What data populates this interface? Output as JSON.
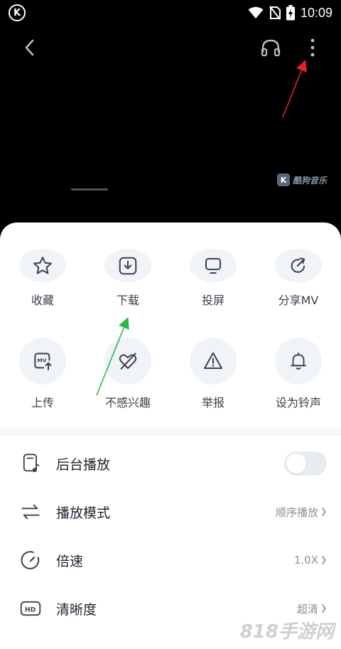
{
  "status": {
    "app_badge": "K",
    "time": "10:09",
    "icons": [
      "wifi-icon",
      "no-sim-icon",
      "battery-icon"
    ]
  },
  "player_nav": {
    "icons": [
      "back-arrow-icon",
      "headphones-icon",
      "more-vertical-icon"
    ]
  },
  "video": {
    "watermark": "酷狗音乐",
    "watermark_logo": "K"
  },
  "actions": [
    {
      "label": "收藏",
      "icon": "star-icon"
    },
    {
      "label": "下载",
      "icon": "download-icon"
    },
    {
      "label": "投屏",
      "icon": "cast-screen-icon"
    },
    {
      "label": "分享MV",
      "icon": "share-icon"
    },
    {
      "label": "上传",
      "icon": "upload-mv-icon"
    },
    {
      "label": "不感兴趣",
      "icon": "not-interested-icon"
    },
    {
      "label": "举报",
      "icon": "report-warning-icon"
    },
    {
      "label": "设为铃声",
      "icon": "bell-icon"
    }
  ],
  "settings": {
    "background_play": {
      "label": "后台播放",
      "enabled": false,
      "icon": "background-play-icon"
    },
    "play_mode": {
      "label": "播放模式",
      "value": "顺序播放",
      "icon": "play-mode-icon"
    },
    "speed": {
      "label": "倍速",
      "value": "1.0X",
      "icon": "speed-gauge-icon"
    },
    "quality": {
      "label": "清晰度",
      "value": "超清",
      "icon": "hd-icon"
    }
  },
  "colors": {
    "sheet_bg": "#ffffff",
    "circle_bg": "#f0f3f7",
    "red_arrow": "#e0252a",
    "green_arrow": "#29b84a"
  },
  "site_watermark": "818手游网"
}
